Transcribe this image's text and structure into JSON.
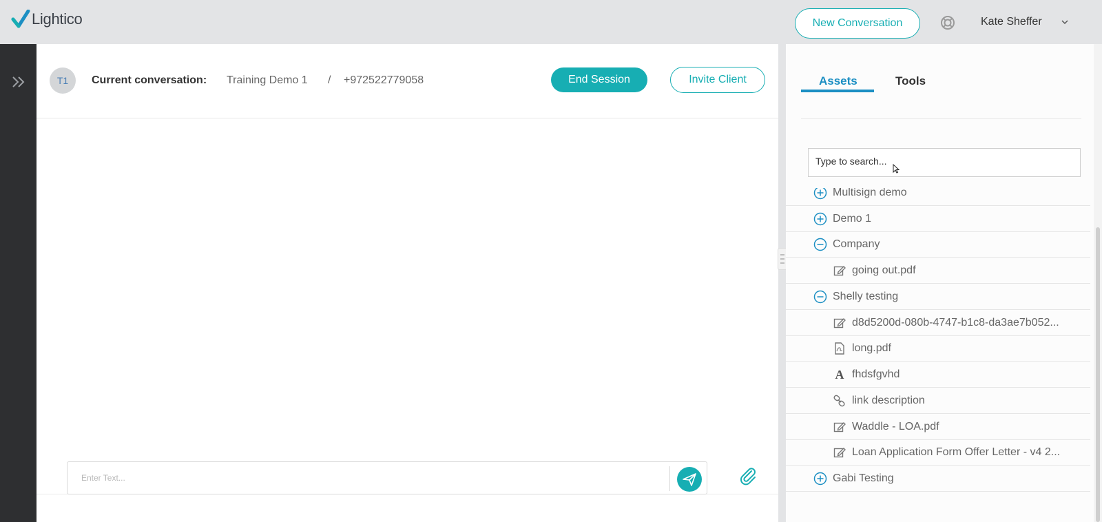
{
  "brand": {
    "name": "Lightico"
  },
  "header": {
    "new_conversation_label": "New Conversation",
    "help_icon": "lifebuoy-icon",
    "user_name": "Kate Sheffer",
    "user_menu_icon": "chevron-down-icon"
  },
  "rail": {
    "expand_icon": "double-chevron-right-icon"
  },
  "conversation": {
    "avatar_initials": "T1",
    "label": "Current conversation:",
    "name": "Training Demo 1",
    "separator": "/",
    "phone": "+972522779058",
    "end_session_label": "End Session",
    "invite_client_label": "Invite Client",
    "composer_placeholder": "Enter Text...",
    "send_icon": "paper-plane-icon",
    "attach_icon": "paperclip-icon"
  },
  "panel": {
    "tabs": [
      {
        "label": "Assets",
        "active": true
      },
      {
        "label": "Tools",
        "active": false
      }
    ],
    "search_placeholder": "Type to search...",
    "assets": [
      {
        "type": "group",
        "state": "collapsed",
        "label": "Multisign demo",
        "icon": "plus-circle-icon"
      },
      {
        "type": "group",
        "state": "collapsed",
        "label": "Demo 1",
        "icon": "plus-circle-icon"
      },
      {
        "type": "group",
        "state": "expanded",
        "label": "Company",
        "icon": "minus-circle-icon"
      },
      {
        "type": "item",
        "label": "going out.pdf",
        "icon": "edit-form-icon"
      },
      {
        "type": "group",
        "state": "expanded",
        "label": "Shelly testing",
        "icon": "minus-circle-icon"
      },
      {
        "type": "item",
        "label": "d8d5200d-080b-4747-b1c8-da3ae7b052...",
        "icon": "edit-form-icon"
      },
      {
        "type": "item",
        "label": "long.pdf",
        "icon": "pdf-file-icon"
      },
      {
        "type": "item",
        "label": "fhdsfgvhd",
        "icon": "text-icon"
      },
      {
        "type": "item",
        "label": "link description",
        "icon": "link-icon"
      },
      {
        "type": "item",
        "label": "Waddle - LOA.pdf",
        "icon": "edit-form-icon"
      },
      {
        "type": "item",
        "label": "Loan Application Form Offer Letter - v4 2...",
        "icon": "edit-form-icon"
      },
      {
        "type": "group",
        "state": "collapsed",
        "label": "Gabi Testing",
        "icon": "plus-circle-icon"
      }
    ]
  },
  "colors": {
    "accent": "#17aeb3",
    "tab_active": "#1c8fc3",
    "rail": "#2e2f31",
    "topbar": "#e3e4e6"
  }
}
